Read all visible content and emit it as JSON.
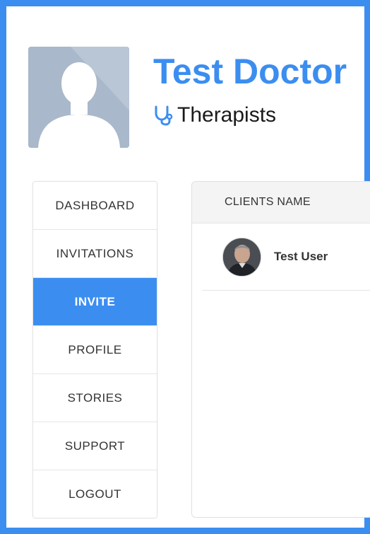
{
  "profile": {
    "name": "Test Doctor",
    "role": "Therapists",
    "role_icon": "stethoscope-icon",
    "avatar_icon": "user-silhouette-icon"
  },
  "sidebar": {
    "items": [
      {
        "label": "DASHBOARD",
        "active": false
      },
      {
        "label": "INVITATIONS",
        "active": false
      },
      {
        "label": "INVITE",
        "active": true
      },
      {
        "label": "PROFILE",
        "active": false
      },
      {
        "label": "STORIES",
        "active": false
      },
      {
        "label": "SUPPORT",
        "active": false
      },
      {
        "label": "LOGOUT",
        "active": false
      }
    ]
  },
  "clients": {
    "header": "CLIENTS NAME",
    "rows": [
      {
        "name": "Test User"
      }
    ]
  },
  "colors": {
    "accent": "#3b8ef0",
    "frame": "#3b8ef0"
  }
}
